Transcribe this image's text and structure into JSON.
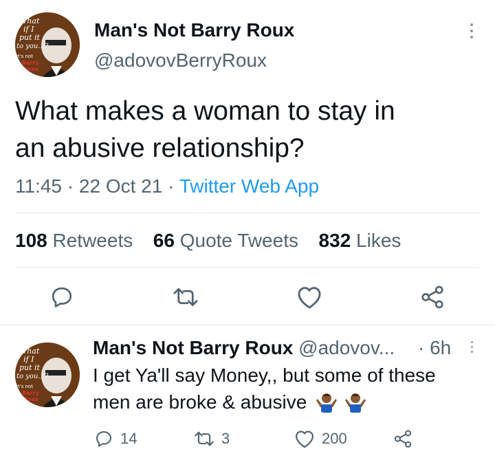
{
  "tweet": {
    "author_name": "Man's Not Barry Roux",
    "author_handle": "@adovovBerryRoux",
    "avatar_text": [
      "What",
      "if I",
      "put it",
      "to you...?",
      "it's not",
      "Barry",
      "Roux"
    ],
    "text_line1": "What makes a woman to stay in",
    "text_line2": "an abusive relationship?",
    "time": "11:45",
    "date": "22 Oct 21",
    "separator": "·",
    "source": "Twitter Web App",
    "stats": {
      "retweets_count": "108",
      "retweets_label": "Retweets",
      "quotes_count": "66",
      "quotes_label": "Quote Tweets",
      "likes_count": "832",
      "likes_label": "Likes"
    }
  },
  "reply": {
    "author_name": "Man's Not Barry Roux",
    "author_handle": "@adovov...",
    "separator": "·",
    "age": "6h",
    "text_line1": "I get Ya'll say Money,, but some of these",
    "text_line2": "men are broke & abusive",
    "emoji_names": [
      "person-shrugging-emoji",
      "person-shrugging-emoji"
    ],
    "actions": {
      "reply_count": "14",
      "retweet_count": "3",
      "like_count": "200"
    }
  },
  "colors": {
    "accent": "#1d9bf0",
    "muted_text": "#536471",
    "divider": "#e6e9ec"
  }
}
